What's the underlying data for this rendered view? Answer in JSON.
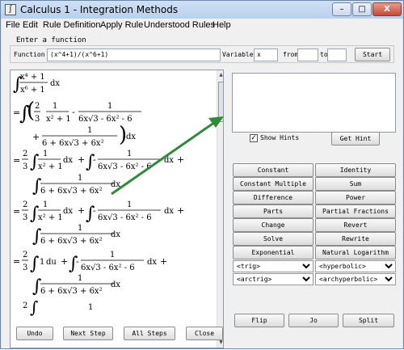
{
  "window": {
    "title": "Calculus 1 - Integration Methods",
    "icon_glyph": "∫",
    "min_glyph": "–",
    "max_glyph": "□",
    "close_glyph": "X"
  },
  "menu": [
    "File",
    "Edit",
    "Rule Definition",
    "Apply Rule",
    "Understood Rules",
    "Help"
  ],
  "input": {
    "header": "Enter a function",
    "function_label": "Function",
    "function_value": "(x^4+1)/(x^6+1)",
    "variable_label": "Variable",
    "variable_value": "x",
    "from_label": "from",
    "from_value": "",
    "to_label": "to",
    "to_value": "",
    "start_label": "Start"
  },
  "hints": {
    "show_hints_label": "Show Hints",
    "show_hints_checked": true,
    "get_hint_label": "Get Hint"
  },
  "rules": [
    [
      "Constant",
      "Identity"
    ],
    [
      "Constant Multiple",
      "Sum"
    ],
    [
      "Difference",
      "Power"
    ],
    [
      "Parts",
      "Partial Fractions"
    ],
    [
      "Change",
      "Revert"
    ],
    [
      "Solve",
      "Rewrite"
    ],
    [
      "Exponential",
      "Natural Logarithm"
    ]
  ],
  "dropdowns": [
    [
      "<trig>",
      "<hyperbolic>"
    ],
    [
      "<arctrig>",
      "<archyperbolic>"
    ]
  ],
  "bottom_right": [
    "Flip",
    "Jo",
    "Split"
  ],
  "bottom_left": [
    "Undo",
    "Next Step",
    "All Steps",
    "Close"
  ],
  "math": {
    "integral": "∫",
    "eq": "=",
    "plus": "+",
    "minus": "-",
    "dx": "dx",
    "du": "du",
    "x4p1": "x⁴ + 1",
    "x6p1": "x⁶ + 1",
    "two": "2",
    "three": "3",
    "one": "1",
    "x2p1": "x² + 1",
    "den_a": "6x√3 - 6x² - 6",
    "den_b": "6 + 6x√3 + 6x²",
    "dot": "·",
    "open_paren": "(",
    "close_paren": ")"
  }
}
